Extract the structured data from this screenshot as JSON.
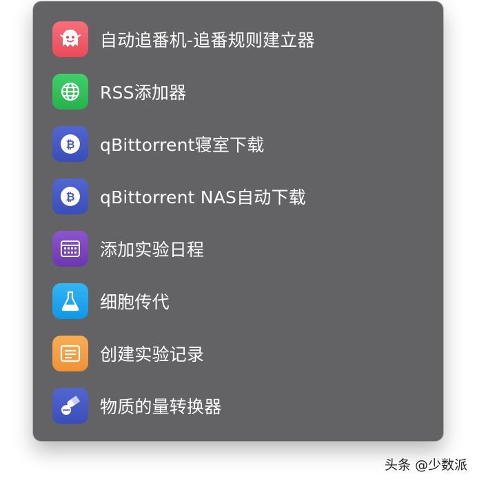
{
  "menu": {
    "items": [
      {
        "label": "自动追番机-追番规则建立器",
        "icon": "ghost-icon",
        "color": "#f25c68"
      },
      {
        "label": "RSS添加器",
        "icon": "globe-icon",
        "color": "#30c25a"
      },
      {
        "label": "qBittorrent寝室下载",
        "icon": "bitcoin-icon",
        "color": "#4458c6"
      },
      {
        "label": "qBittorrent NAS自动下载",
        "icon": "bitcoin-icon",
        "color": "#4458c6"
      },
      {
        "label": "添加实验日程",
        "icon": "calendar-icon",
        "color": "#7f45c0"
      },
      {
        "label": "细胞传代",
        "icon": "flask-icon",
        "color": "#1ea7f0"
      },
      {
        "label": "创建实验记录",
        "icon": "note-icon",
        "color": "#f5a040"
      },
      {
        "label": "物质的量转换器",
        "icon": "pills-icon",
        "color": "#4458c6"
      }
    ]
  },
  "watermark": "头条 @少数派"
}
